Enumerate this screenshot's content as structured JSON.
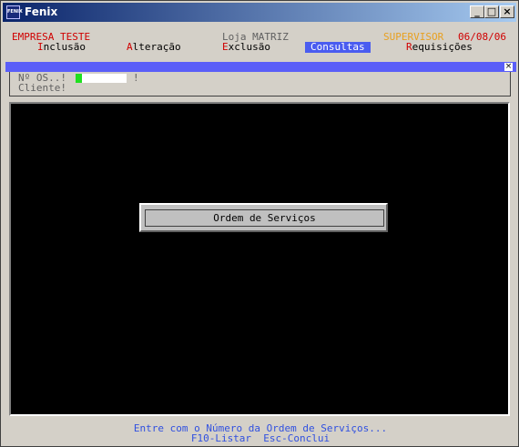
{
  "window": {
    "title": "Fenix",
    "icon_text": "FENIX",
    "minimize": "_",
    "maximize": "□",
    "close": "×"
  },
  "header": {
    "company": "EMPRESA TESTE",
    "store": "Loja MATRIZ",
    "user": "SUPERVISOR",
    "date": "06/08/06"
  },
  "menu": {
    "inclusao": {
      "hot": "I",
      "rest": "nclusão"
    },
    "alteracao": {
      "hot": "A",
      "rest": "lteração"
    },
    "exclusao": {
      "hot": "E",
      "rest": "xclusão"
    },
    "consultas": "Consultas",
    "requisicoes": {
      "hot": "R",
      "rest": "equisições"
    }
  },
  "form": {
    "os_label": "Nº OS..!",
    "os_suffix": "!",
    "cliente_label": "Cliente!",
    "os_value": ""
  },
  "bar_close": "×",
  "dialog": {
    "label": "Ordem de Serviços"
  },
  "status": {
    "line1": "Entre com o Número da Ordem de Serviços...",
    "line2": "F10-Listar  Esc-Conclui"
  },
  "colors": {
    "accent": "#4a5cf0",
    "hotkey": "#d00000",
    "status": "#3050e0",
    "user": "#e8a020"
  }
}
